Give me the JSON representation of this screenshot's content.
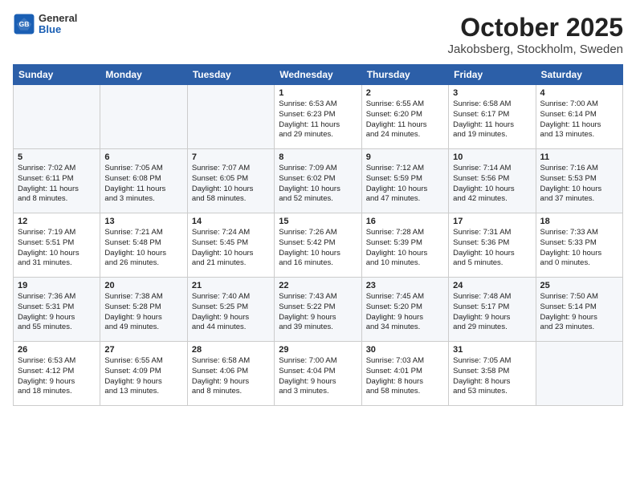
{
  "header": {
    "logo_general": "General",
    "logo_blue": "Blue",
    "title": "October 2025",
    "subtitle": "Jakobsberg, Stockholm, Sweden"
  },
  "weekdays": [
    "Sunday",
    "Monday",
    "Tuesday",
    "Wednesday",
    "Thursday",
    "Friday",
    "Saturday"
  ],
  "weeks": [
    [
      {
        "day": "",
        "info": ""
      },
      {
        "day": "",
        "info": ""
      },
      {
        "day": "",
        "info": ""
      },
      {
        "day": "1",
        "info": "Sunrise: 6:53 AM\nSunset: 6:23 PM\nDaylight: 11 hours\nand 29 minutes."
      },
      {
        "day": "2",
        "info": "Sunrise: 6:55 AM\nSunset: 6:20 PM\nDaylight: 11 hours\nand 24 minutes."
      },
      {
        "day": "3",
        "info": "Sunrise: 6:58 AM\nSunset: 6:17 PM\nDaylight: 11 hours\nand 19 minutes."
      },
      {
        "day": "4",
        "info": "Sunrise: 7:00 AM\nSunset: 6:14 PM\nDaylight: 11 hours\nand 13 minutes."
      }
    ],
    [
      {
        "day": "5",
        "info": "Sunrise: 7:02 AM\nSunset: 6:11 PM\nDaylight: 11 hours\nand 8 minutes."
      },
      {
        "day": "6",
        "info": "Sunrise: 7:05 AM\nSunset: 6:08 PM\nDaylight: 11 hours\nand 3 minutes."
      },
      {
        "day": "7",
        "info": "Sunrise: 7:07 AM\nSunset: 6:05 PM\nDaylight: 10 hours\nand 58 minutes."
      },
      {
        "day": "8",
        "info": "Sunrise: 7:09 AM\nSunset: 6:02 PM\nDaylight: 10 hours\nand 52 minutes."
      },
      {
        "day": "9",
        "info": "Sunrise: 7:12 AM\nSunset: 5:59 PM\nDaylight: 10 hours\nand 47 minutes."
      },
      {
        "day": "10",
        "info": "Sunrise: 7:14 AM\nSunset: 5:56 PM\nDaylight: 10 hours\nand 42 minutes."
      },
      {
        "day": "11",
        "info": "Sunrise: 7:16 AM\nSunset: 5:53 PM\nDaylight: 10 hours\nand 37 minutes."
      }
    ],
    [
      {
        "day": "12",
        "info": "Sunrise: 7:19 AM\nSunset: 5:51 PM\nDaylight: 10 hours\nand 31 minutes."
      },
      {
        "day": "13",
        "info": "Sunrise: 7:21 AM\nSunset: 5:48 PM\nDaylight: 10 hours\nand 26 minutes."
      },
      {
        "day": "14",
        "info": "Sunrise: 7:24 AM\nSunset: 5:45 PM\nDaylight: 10 hours\nand 21 minutes."
      },
      {
        "day": "15",
        "info": "Sunrise: 7:26 AM\nSunset: 5:42 PM\nDaylight: 10 hours\nand 16 minutes."
      },
      {
        "day": "16",
        "info": "Sunrise: 7:28 AM\nSunset: 5:39 PM\nDaylight: 10 hours\nand 10 minutes."
      },
      {
        "day": "17",
        "info": "Sunrise: 7:31 AM\nSunset: 5:36 PM\nDaylight: 10 hours\nand 5 minutes."
      },
      {
        "day": "18",
        "info": "Sunrise: 7:33 AM\nSunset: 5:33 PM\nDaylight: 10 hours\nand 0 minutes."
      }
    ],
    [
      {
        "day": "19",
        "info": "Sunrise: 7:36 AM\nSunset: 5:31 PM\nDaylight: 9 hours\nand 55 minutes."
      },
      {
        "day": "20",
        "info": "Sunrise: 7:38 AM\nSunset: 5:28 PM\nDaylight: 9 hours\nand 49 minutes."
      },
      {
        "day": "21",
        "info": "Sunrise: 7:40 AM\nSunset: 5:25 PM\nDaylight: 9 hours\nand 44 minutes."
      },
      {
        "day": "22",
        "info": "Sunrise: 7:43 AM\nSunset: 5:22 PM\nDaylight: 9 hours\nand 39 minutes."
      },
      {
        "day": "23",
        "info": "Sunrise: 7:45 AM\nSunset: 5:20 PM\nDaylight: 9 hours\nand 34 minutes."
      },
      {
        "day": "24",
        "info": "Sunrise: 7:48 AM\nSunset: 5:17 PM\nDaylight: 9 hours\nand 29 minutes."
      },
      {
        "day": "25",
        "info": "Sunrise: 7:50 AM\nSunset: 5:14 PM\nDaylight: 9 hours\nand 23 minutes."
      }
    ],
    [
      {
        "day": "26",
        "info": "Sunrise: 6:53 AM\nSunset: 4:12 PM\nDaylight: 9 hours\nand 18 minutes."
      },
      {
        "day": "27",
        "info": "Sunrise: 6:55 AM\nSunset: 4:09 PM\nDaylight: 9 hours\nand 13 minutes."
      },
      {
        "day": "28",
        "info": "Sunrise: 6:58 AM\nSunset: 4:06 PM\nDaylight: 9 hours\nand 8 minutes."
      },
      {
        "day": "29",
        "info": "Sunrise: 7:00 AM\nSunset: 4:04 PM\nDaylight: 9 hours\nand 3 minutes."
      },
      {
        "day": "30",
        "info": "Sunrise: 7:03 AM\nSunset: 4:01 PM\nDaylight: 8 hours\nand 58 minutes."
      },
      {
        "day": "31",
        "info": "Sunrise: 7:05 AM\nSunset: 3:58 PM\nDaylight: 8 hours\nand 53 minutes."
      },
      {
        "day": "",
        "info": ""
      }
    ]
  ]
}
